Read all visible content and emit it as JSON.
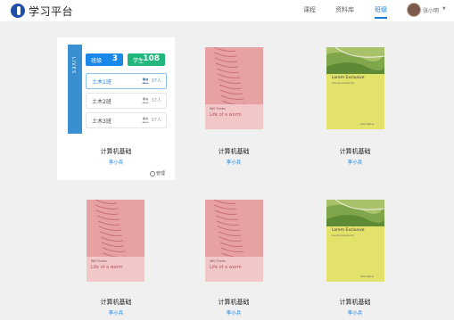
{
  "app": {
    "title": "学习平台"
  },
  "nav": {
    "items": [
      {
        "label": "课程",
        "active": false
      },
      {
        "label": "资料库",
        "active": false
      },
      {
        "label": "班级",
        "active": true
      }
    ]
  },
  "user": {
    "name": "张小明"
  },
  "featured": {
    "spine_text": "LIVES",
    "stats": [
      {
        "label": "班级",
        "value": "3"
      },
      {
        "label": "学生",
        "value": "108"
      }
    ],
    "classes": [
      {
        "name": "土木1班",
        "count": "37人",
        "selected": true
      },
      {
        "name": "土木2班",
        "count": "37人",
        "selected": false
      },
      {
        "name": "土木3班",
        "count": "37人",
        "selected": false
      }
    ],
    "manage_label": "管理"
  },
  "courses": [
    {
      "title": "计算机基础",
      "author": "李小兵",
      "cover": "blue"
    },
    {
      "title": "计算机基础",
      "author": "李小兵",
      "cover": "pink",
      "cover_title": "Life of a worm",
      "cover_author": "Will Flores"
    },
    {
      "title": "计算机基础",
      "author": "李小兵",
      "cover": "yellow",
      "cover_title": "Lorem Exclusive",
      "cover_sub": "Cauda Gradeunt",
      "cover_author": "Alex Neue"
    },
    {
      "title": "计算机基础",
      "author": "李小兵",
      "cover": "pink",
      "cover_title": "Life of a worm",
      "cover_author": "Will Flores"
    },
    {
      "title": "计算机基础",
      "author": "李小兵",
      "cover": "pink",
      "cover_title": "Life of a worm",
      "cover_author": "Will Flores"
    },
    {
      "title": "计算机基础",
      "author": "李小兵",
      "cover": "yellow",
      "cover_title": "Lorem Exclusive",
      "cover_sub": "Cauda Gradeunt",
      "cover_author": "Alex Neue"
    }
  ],
  "colors": {
    "accent": "#1a7bd6",
    "stat_blue": "#1a88e8",
    "stat_green": "#21b67b",
    "pink_cover": "#e8a1a3",
    "yellow_cover": "#e3e36b"
  }
}
